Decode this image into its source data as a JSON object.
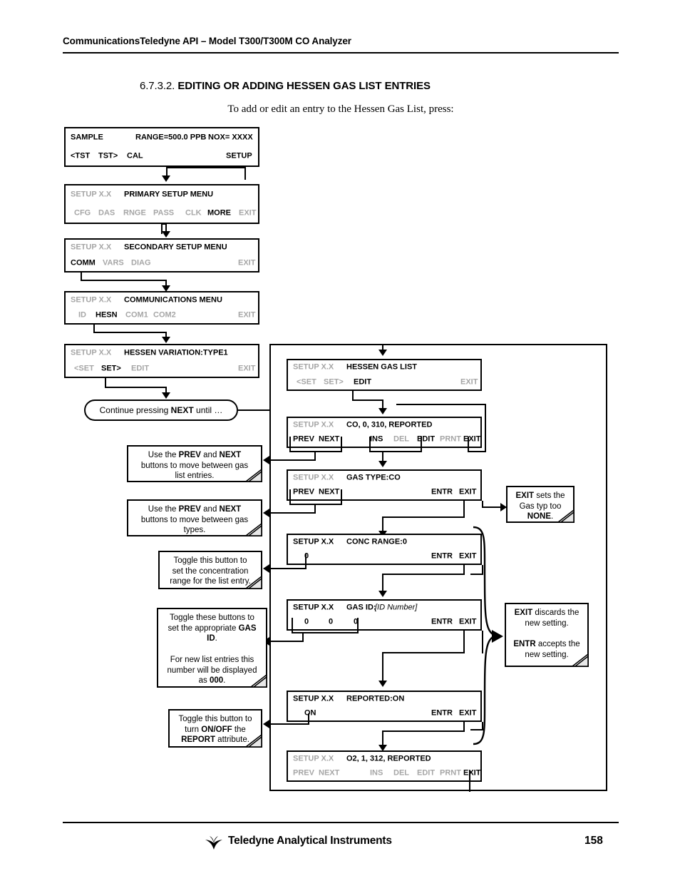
{
  "header": {
    "title": "CommunicationsTeledyne API – Model T300/T300M CO Analyzer"
  },
  "section": {
    "number": "6.7.3.2.",
    "title": "EDITING OR ADDING HESSEN GAS LIST ENTRIES",
    "intro": "To add or edit an entry to the Hessen Gas List, press:"
  },
  "panels": {
    "sample": {
      "status": "SAMPLE",
      "range": "RANGE=500.0 PPB",
      "nox": "NOX= XXXX",
      "btn_tst_prev": "<TST",
      "btn_tst_next": "TST>",
      "btn_cal": "CAL",
      "btn_setup": "SETUP"
    },
    "primary_setup": {
      "setup_label": "SETUP X.X",
      "title": "PRIMARY SETUP MENU",
      "btn_cfg": "CFG",
      "btn_das": "DAS",
      "btn_rnge": "RNGE",
      "btn_pass": "PASS",
      "btn_clk": "CLK",
      "btn_more": "MORE",
      "btn_exit": "EXIT"
    },
    "secondary_setup": {
      "setup_label": "SETUP X.X",
      "title": "SECONDARY SETUP MENU",
      "btn_comm": "COMM",
      "btn_vars": "VARS",
      "btn_diag": "DIAG",
      "btn_exit": "EXIT"
    },
    "communications": {
      "setup_label": "SETUP X.X",
      "title": "COMMUNICATIONS MENU",
      "btn_id": "ID",
      "btn_hesn": "HESN",
      "btn_com1": "COM1",
      "btn_com2": "COM2",
      "btn_exit": "EXIT"
    },
    "hessen_variation": {
      "setup_label": "SETUP X.X",
      "title": "HESSEN VARIATION:TYPE1",
      "btn_set_prev": "<SET",
      "btn_set_next": "SET>",
      "btn_edit": "EDIT",
      "btn_exit": "EXIT"
    },
    "hessen_gas_list": {
      "setup_label": "SETUP X.X",
      "title": "HESSEN GAS LIST",
      "btn_set_prev": "<SET",
      "btn_set_next": "SET>",
      "btn_edit": "EDIT",
      "btn_exit": "EXIT"
    },
    "gas_entry_co": {
      "setup_label": "SETUP X.X",
      "title": "CO, 0, 310, REPORTED",
      "btn_prev": "PREV",
      "btn_next": "NEXT",
      "btn_ins": "INS",
      "btn_del": "DEL",
      "btn_edit": "EDIT",
      "btn_prnt": "PRNT",
      "btn_exit": "EXIT"
    },
    "gas_type": {
      "setup_label": "SETUP X.X",
      "title": "GAS TYPE:CO",
      "btn_prev": "PREV",
      "btn_next": "NEXT",
      "btn_entr": "ENTR",
      "btn_exit": "EXIT"
    },
    "conc_range": {
      "setup_label": "SETUP X.X",
      "title": "CONC RANGE:0",
      "value": "0",
      "btn_entr": "ENTR",
      "btn_exit": "EXIT"
    },
    "gas_id": {
      "setup_label": "SETUP X.X",
      "title_main": "GAS ID:",
      "title_italic": "[ID Number]",
      "digit1": "0",
      "digit2": "0",
      "digit3": "0",
      "btn_entr": "ENTR",
      "btn_exit": "EXIT"
    },
    "reported": {
      "setup_label": "SETUP X.X",
      "title": "REPORTED:ON",
      "value": "ON",
      "btn_entr": "ENTR",
      "btn_exit": "EXIT"
    },
    "gas_entry_o2": {
      "setup_label": "SETUP X.X",
      "title": "O2, 1, 312, REPORTED",
      "btn_prev": "PREV",
      "btn_next": "NEXT",
      "btn_ins": "INS",
      "btn_del": "DEL",
      "btn_edit": "EDIT",
      "btn_prnt": "PRNT",
      "btn_exit": "EXIT"
    }
  },
  "callouts": {
    "continue_next": {
      "pre": "Continue pressing ",
      "bold": "NEXT",
      "post": " until …"
    },
    "prev_next_entries": {
      "l1_pre": "Use the ",
      "l1_b1": "PREV",
      "l1_mid": " and ",
      "l1_b2": "NEXT",
      "l2": "buttons to move between gas",
      "l3": "list entries."
    },
    "prev_next_types": {
      "l1_pre": "Use the ",
      "l1_b1": "PREV",
      "l1_mid": " and ",
      "l1_b2": "NEXT",
      "l2": "buttons to move between gas",
      "l3": "types."
    },
    "conc_toggle": {
      "l1": "Toggle this button to",
      "l2": "set the concentration",
      "l3": "range for the list entry."
    },
    "gas_id_toggle": {
      "l1": "Toggle these buttons to",
      "l2_pre": "set the appropriate ",
      "l2_b": "GAS",
      "l3_b": "ID",
      "l3_post": ".",
      "l4": "For new list entries this",
      "l5": "number will be displayed",
      "l6_pre": "as ",
      "l6_b": "000",
      "l6_post": "."
    },
    "report_toggle": {
      "l1": "Toggle this button to",
      "l2_pre": "turn ",
      "l2_b": "ON/OFF",
      "l2_post": " the",
      "l3_b": "REPORT",
      "l3_post": " attribute."
    },
    "exit_none": {
      "l1_b": "EXIT",
      "l1_post": " sets the",
      "l2": "Gas typ too",
      "l3_b": "NONE",
      "l3_post": "."
    },
    "exit_entr": {
      "l1_b": "EXIT",
      "l1_post": " discards the",
      "l2": "new setting.",
      "l3_b": "ENTR",
      "l3_post": " accepts the",
      "l4": "new setting."
    }
  },
  "footer": {
    "company": "Teledyne Analytical Instruments",
    "page": "158"
  }
}
